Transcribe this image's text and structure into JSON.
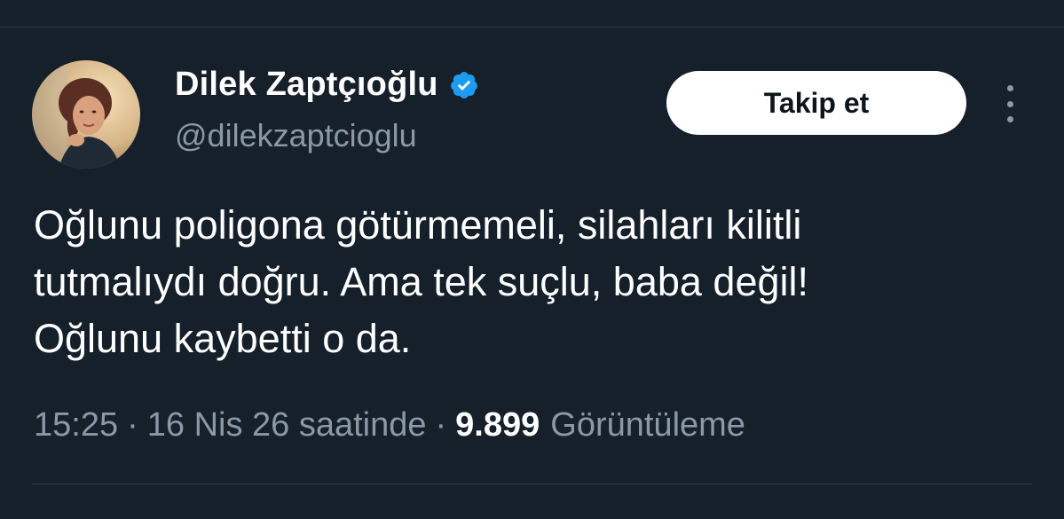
{
  "author": {
    "display_name": "Dilek Zaptçıoğlu",
    "handle": "@dilekzaptcioglu",
    "verified": true
  },
  "actions": {
    "follow_label": "Takip et"
  },
  "tweet": {
    "lines": [
      "Oğlunu poligona götürmemeli, silahları kilitli",
      "tutmalıydı doğru. Ama tek suçlu, baba değil!",
      "Oğlunu kaybetti o da."
    ]
  },
  "meta": {
    "time": "15:25",
    "separator": "·",
    "date": "16 Nis 26 saatinde",
    "views_count": "9.899",
    "views_label": "Görüntüleme"
  },
  "colors": {
    "background": "#15202b",
    "text_primary": "#ffffff",
    "text_secondary": "#8b98a5",
    "verified_badge": "#1d9bf0",
    "follow_button_bg": "#ffffff",
    "follow_button_text": "#0f1419"
  },
  "icons": {
    "verified": "verified-badge-icon",
    "more": "more-options-icon"
  }
}
